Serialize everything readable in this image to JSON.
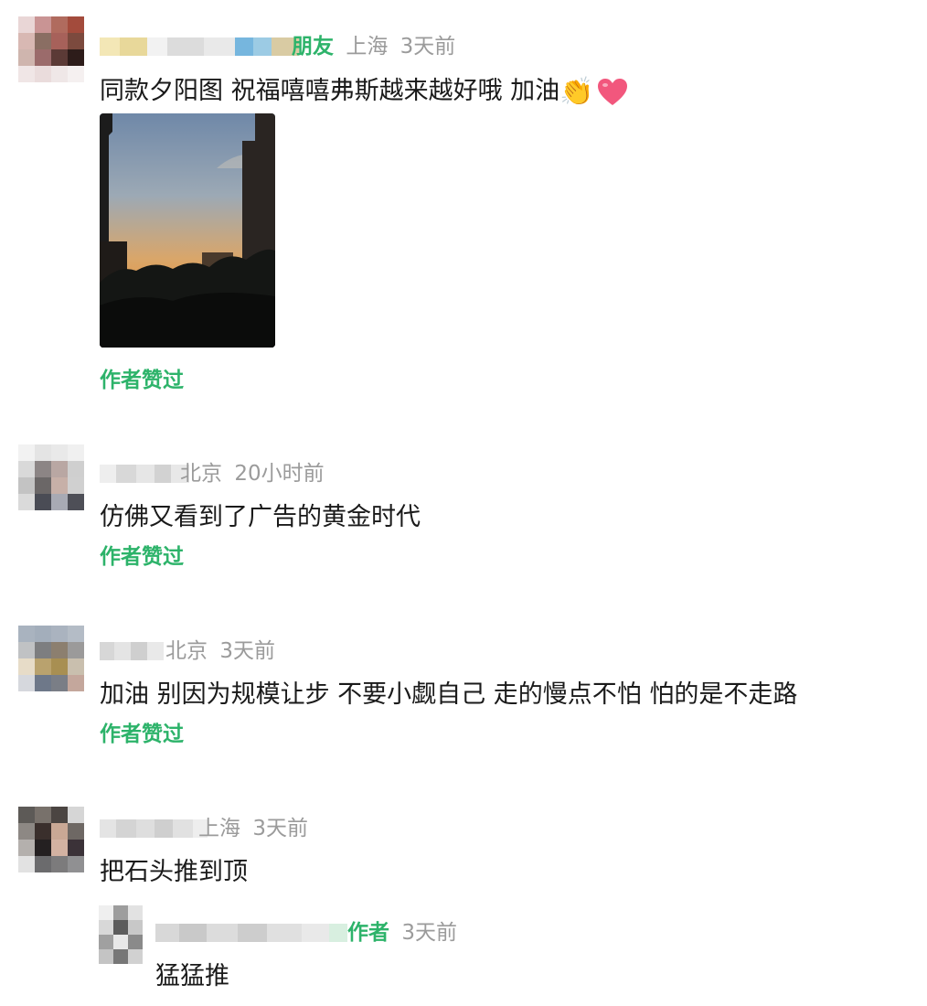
{
  "comments": [
    {
      "tag": "朋友",
      "location": "上海",
      "time": "3天前",
      "text": "同款夕阳图 祝福嘻嘻弗斯越来越好哦 加油",
      "liked": "作者赞过"
    },
    {
      "location": "北京",
      "time": "20小时前",
      "text": "仿佛又看到了广告的黄金时代",
      "liked": "作者赞过"
    },
    {
      "location": "北京",
      "time": "3天前",
      "text": "加油 别因为规模让步 不要小觑自己 走的慢点不怕 怕的是不走路",
      "liked": "作者赞过"
    },
    {
      "location": "上海",
      "time": "3天前",
      "text": "把石头推到顶"
    }
  ],
  "reply": {
    "tag_partial": "作者",
    "time": "3天前",
    "text": "猛猛推"
  },
  "colors": {
    "accent": "#2db36a",
    "meta": "#9b9b9b"
  },
  "icons": [
    "clap-emoji",
    "heart-emoji"
  ]
}
